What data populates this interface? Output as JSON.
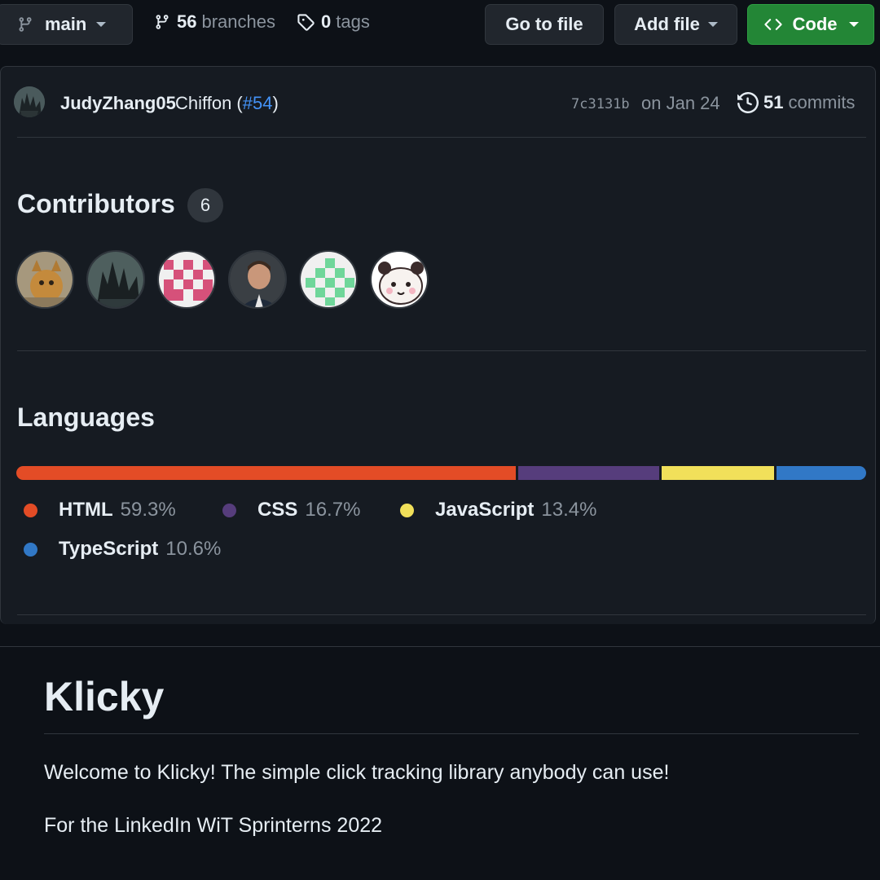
{
  "toolbar": {
    "branch": "main",
    "branches_count": "56",
    "branches_label": "branches",
    "tags_count": "0",
    "tags_label": "tags",
    "goto_file": "Go to file",
    "add_file": "Add file",
    "code": "Code"
  },
  "commit": {
    "author": "JudyZhang05",
    "message": "Chiffon (",
    "pr": "#54",
    "message_end": ")",
    "sha": "7c3131b",
    "date": "on Jan 24",
    "count": "51",
    "count_label": "commits"
  },
  "contributors": {
    "title": "Contributors",
    "count": "6"
  },
  "languages": {
    "title": "Languages",
    "items": [
      {
        "name": "HTML",
        "percent": "59.3%",
        "value": 59.3,
        "color": "#e34c26"
      },
      {
        "name": "CSS",
        "percent": "16.7%",
        "value": 16.7,
        "color": "#563d7c"
      },
      {
        "name": "JavaScript",
        "percent": "13.4%",
        "value": 13.4,
        "color": "#f1e05a"
      },
      {
        "name": "TypeScript",
        "percent": "10.6%",
        "value": 10.6,
        "color": "#3178c6"
      }
    ]
  },
  "readme": {
    "title": "Klicky",
    "paragraph1": "Welcome to Klicky! The simple click tracking library anybody can use!",
    "paragraph2": "For the LinkedIn WiT Sprinterns 2022"
  }
}
